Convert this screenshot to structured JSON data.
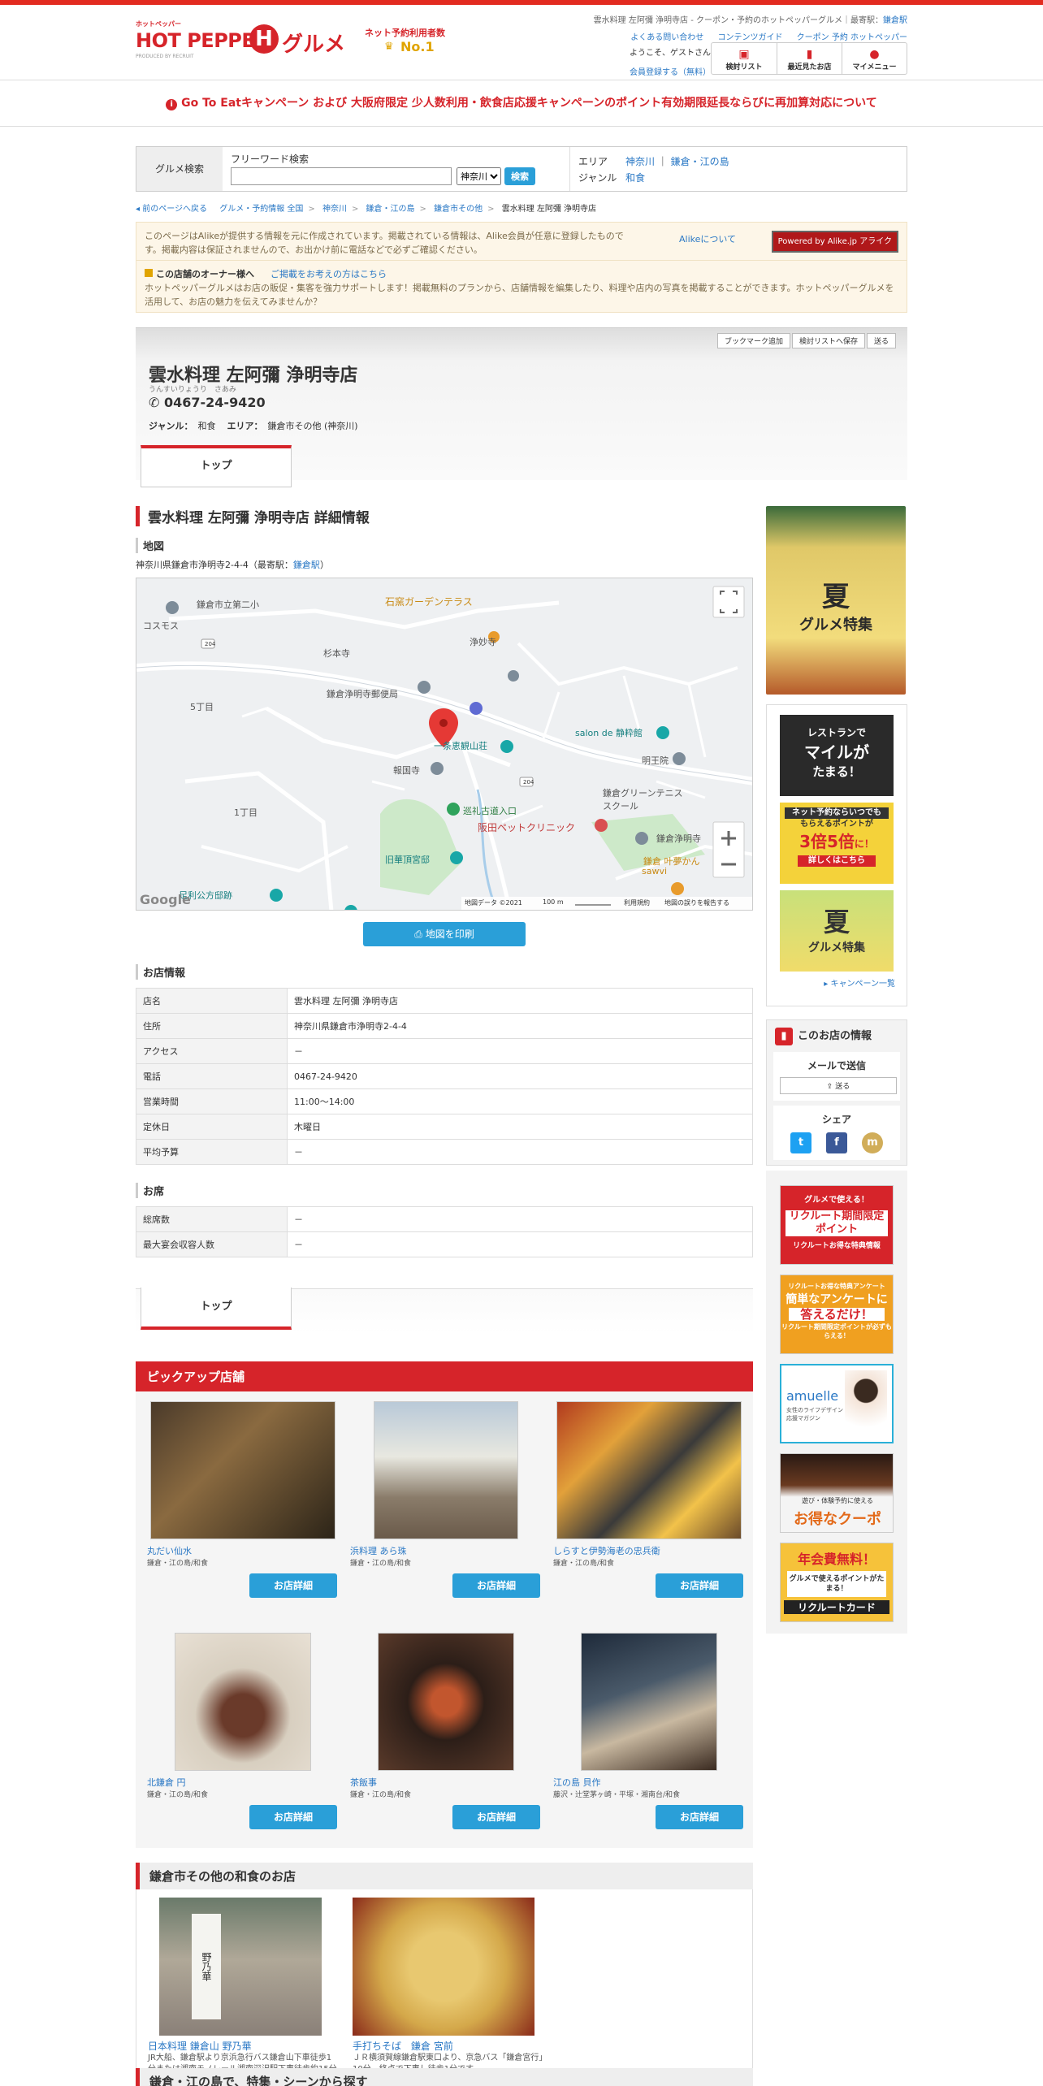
{
  "topbar": {
    "description": "雲水料理 左阿彌 浄明寺店 - クーポン・予約のホットペッパーグルメ",
    "station_label": "最寄駅：",
    "station": "鎌倉駅",
    "links": [
      "よくある問い合わせ",
      "コンテンツガイド",
      "クーポン 予約 ホットペッパー"
    ],
    "welcome": "ようこそ、ゲストさん",
    "register": "会員登録する（無料）",
    "buttons": [
      "検討リスト",
      "最近見たお店",
      "マイメニュー"
    ]
  },
  "logo": {
    "hotpepper_small": "ホットペッパー",
    "hotpepper": "HOT PEPPER",
    "h": "H",
    "gourmet": "グルメ",
    "produced": "PRODUCED BY RECRUIT",
    "no1_label": "ネット予約利用者数",
    "no1": "No.1"
  },
  "notice": "Go To Eatキャンペーン および 大阪府限定 少人数利用・飲食店応援キャンペーンのポイント有効期限延長ならびに再加算対応について",
  "search": {
    "label": "グルメ検索",
    "freeword_title": "フリーワード検索",
    "freeword_value": "",
    "area_select": "神奈川",
    "submit": "検索",
    "cond_area_label": "エリア",
    "cond_area_1": "神奈川",
    "cond_area_2": "鎌倉・江の島",
    "cond_genre_label": "ジャンル",
    "cond_genre": "和食"
  },
  "breadcrumb": [
    "前のページへ戻る",
    "グルメ・予約情報 全国",
    "神奈川",
    "鎌倉・江の島",
    "鎌倉市その他",
    "雲水料理 左阿彌 浄明寺店"
  ],
  "alike": {
    "text": "このページはAlikeが提供する情報を元に作成されています。掲載されている情報は、Alike会員が任意に登録したものです。掲載内容は保証されませんので、お出かけ前に電話などで必ずご確認ください。",
    "link": "Alikeについて",
    "powered": "Powered by Alike.jp アライク"
  },
  "owner": {
    "title": "この店舗のオーナー様へ",
    "link": "ご掲載をお考えの方はこちら",
    "text": "ホットペッパーグルメはお店の販促・集客を強力サポートします！掲載無料のプランから、店舗情報を編集したり、料理や店内の写真を掲載することができます。ホットペッパーグルメを活用して、お店の魅力を伝えてみませんか？"
  },
  "shop": {
    "actions": [
      "ブックマーク追加",
      "検討リストへ保存",
      "送る"
    ],
    "name": "雲水料理 左阿彌 浄明寺店",
    "kana": "うんすいりょうり　さあみ",
    "tel": "0467-24-9420",
    "genre_label": "ジャンル：",
    "genre": "和食",
    "area_label": "エリア：",
    "area": "鎌倉市その他 (神奈川)",
    "tab": "トップ"
  },
  "detail": {
    "title": "雲水料理 左阿彌 浄明寺店 詳細情報",
    "map_heading": "地図",
    "address_line": "神奈川県鎌倉市浄明寺2-4-4（最寄駅：",
    "address_station": "鎌倉駅",
    "address_close": "）",
    "map_labels": {
      "l1": "鎌倉市立第二小",
      "l2": "石窯ガーデンテラス",
      "l3": "コスモス",
      "l4": "杉本寺",
      "l5": "浄妙寺",
      "l6": "鎌倉浄明寺郵便局",
      "l7": "一条恵観山荘",
      "l8": "salon de 静粋館",
      "l9": "報国寺",
      "l10": "明王院",
      "l11": "鎌倉グリーンテニススクール",
      "l12": "巡礼古道入口",
      "l13": "阪田ペットクリニック",
      "l14": "旧華頂宮邸",
      "l15": "鎌倉 叶夢かん",
      "l16": "足利公方邸跡",
      "l17": "5丁目",
      "l18": "1丁目",
      "l19": "sawvi",
      "l20": "鎌倉浄明寺",
      "google": "Google",
      "copyright": "地図データ ©2021",
      "scale": "100 m",
      "terms": "利用規約",
      "report": "地図の誤りを報告する",
      "road_204a": "204",
      "road_204b": "204"
    },
    "print_btn": "地図を印刷",
    "info_heading": "お店情報",
    "info_rows": [
      {
        "k": "店名",
        "v": "雲水料理 左阿彌 浄明寺店"
      },
      {
        "k": "住所",
        "v": "神奈川県鎌倉市浄明寺2-4-4"
      },
      {
        "k": "アクセス",
        "v": "－"
      },
      {
        "k": "電話",
        "v": "0467-24-9420"
      },
      {
        "k": "営業時間",
        "v": "11:00～14:00"
      },
      {
        "k": "定休日",
        "v": "木曜日"
      },
      {
        "k": "平均予算",
        "v": "－"
      }
    ],
    "seat_heading": "お席",
    "seat_rows": [
      {
        "k": "総席数",
        "v": "－"
      },
      {
        "k": "最大宴会収容人数",
        "v": "－"
      }
    ],
    "bottom_tab": "トップ"
  },
  "pickup": {
    "title": "ピックアップ店舗",
    "button": "お店詳細",
    "items": [
      {
        "name": "丸だい仙水",
        "area": "鎌倉・江の島/和食"
      },
      {
        "name": "浜料理 あら珠",
        "area": "鎌倉・江の島/和食"
      },
      {
        "name": "しらすと伊勢海老の忠兵衛",
        "area": "鎌倉・江の島/和食"
      },
      {
        "name": "北鎌倉 円",
        "area": "鎌倉・江の島/和食"
      },
      {
        "name": "茶飯事",
        "area": "鎌倉・江の島/和食"
      },
      {
        "name": "江の島 貝作",
        "area": "藤沢・辻堂茅ヶ崎・平塚・湘南台/和食"
      }
    ]
  },
  "other": {
    "title": "鎌倉市その他の和食のお店",
    "items": [
      {
        "name": "日本料理 鎌倉山 野乃華",
        "desc": "JR大船、鎌倉駅より京浜急行バス鎌倉山下車徒歩1分または湘南モノレール湘南深沢駅下車徒歩約15分",
        "sign": "野乃華"
      },
      {
        "name": "手打ちそば　鎌倉 宮前",
        "desc": "ＪＲ横須賀線鎌倉駅東口より、京急バス「鎌倉宮行」10分。終点で下車し徒歩1分です。"
      }
    ]
  },
  "bottom_bar": "鎌倉・江の島で、特集・シーンから探す",
  "side": {
    "b1_title": "夏",
    "b1_sub": "グルメ特集",
    "s1a": "レストランで",
    "s1b": "マイルが",
    "s1c": "たまる！",
    "s2a": "ネット予約ならいつでも",
    "s2b": "もらえるポイントが",
    "s2c": "3倍",
    "s2d": "5倍",
    "s2e": "に！",
    "s2f": "詳しくはこちら",
    "s3a": "夏",
    "s3b": "グルメ特集",
    "campaign_link": "キャンペーン一覧",
    "shop_info_title": "このお店の情報",
    "mail_label": "メールで送信",
    "send": "送る",
    "share_label": "シェア",
    "share_twitter": "t",
    "share_facebook": "f",
    "share_mixi": "m",
    "r1a": "グルメで使える！",
    "r1b": "リクルート期間限定ポイント",
    "r1c": "リクルートお得な特典情報",
    "r2a": "リクルートお得な特典アンケート",
    "r2b": "簡単なアンケートに",
    "r2c": "答えるだけ！",
    "r2d": "リクルート期間限定ポイントが必ずもらえる！",
    "r3a": "amuelle",
    "r3b": "女性のライフデザイン応援マガジン",
    "r4a": "遊び・体験予約に使える",
    "r4b": "お得なクーポン。",
    "r5a": "年会費無料！",
    "r5b": "グルメで使えるポイントがたまる！",
    "r5c": "リクルートカード"
  },
  "colors": {
    "brand_red": "#d6242a",
    "link_blue": "#2a78c5",
    "button_blue": "#2a9fd8"
  }
}
